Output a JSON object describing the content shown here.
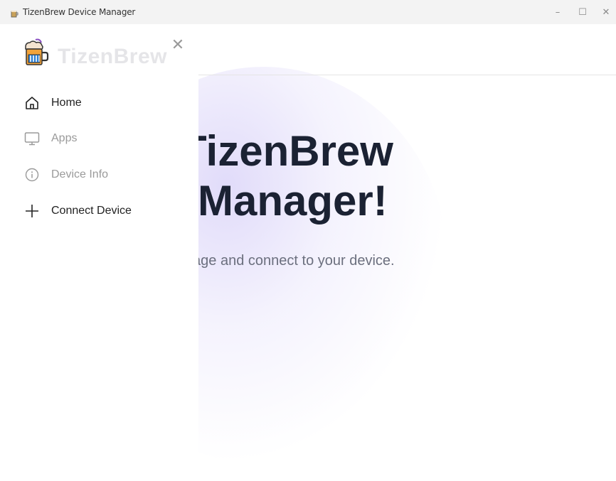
{
  "window": {
    "title": "TizenBrew Device Manager",
    "minimize": "–",
    "maximize": "☐",
    "close": "✕"
  },
  "drawer": {
    "brand": "TizenBrew",
    "close": "✕",
    "items": [
      {
        "label": "Home",
        "icon": "home-icon",
        "enabled": true
      },
      {
        "label": "Apps",
        "icon": "monitor-icon",
        "enabled": false
      },
      {
        "label": "Device Info",
        "icon": "info-icon",
        "enabled": false
      },
      {
        "label": "Connect Device",
        "icon": "plus-icon",
        "enabled": true
      }
    ]
  },
  "main": {
    "title_line1": "ne to TizenBrew",
    "title_line2": "Manager!",
    "subtitle": "\"Connect Device\" page and connect to your device."
  },
  "colors": {
    "title": "#1b2233",
    "subtitle": "#6b6f7e",
    "disabled": "#9a9a9a",
    "accent_glow": "#c8bef5"
  }
}
